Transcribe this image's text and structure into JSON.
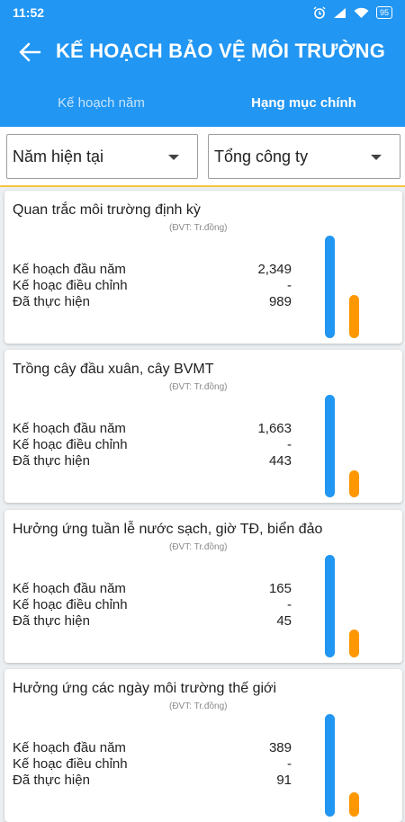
{
  "status_bar": {
    "time": "11:52",
    "battery": "95"
  },
  "app_bar": {
    "title": "KẾ HOẠCH BẢO VỆ MÔI TRƯỜNG"
  },
  "tabs": [
    {
      "label": "Kế hoạch năm",
      "active": false
    },
    {
      "label": "Hạng mục chính",
      "active": true
    }
  ],
  "filters": {
    "period": "Năm hiện tại",
    "unit": "Tổng công ty"
  },
  "labels": {
    "plan": "Kế hoạch đầu năm",
    "adjusted": "Kế hoạc điều chỉnh",
    "done": "Đã thực hiện",
    "unit": "(ĐVT: Tr.đồng)"
  },
  "colors": {
    "primary": "#2196f3",
    "plan_bar": "#2196f3",
    "done_bar": "#ff9800",
    "divider": "#f5c542"
  },
  "items": [
    {
      "title": "Quan trắc môi trường định kỳ",
      "plan": "2,349",
      "adjusted": "-",
      "done": "989",
      "plan_value": 2349,
      "done_value": 989
    },
    {
      "title": "Trồng cây đầu xuân, cây BVMT",
      "plan": "1,663",
      "adjusted": "-",
      "done": "443",
      "plan_value": 1663,
      "done_value": 443
    },
    {
      "title": "Hưởng ứng tuần lễ nước sạch, giờ TĐ, biển đảo",
      "plan": "165",
      "adjusted": "-",
      "done": "45",
      "plan_value": 165,
      "done_value": 45
    },
    {
      "title": "Hưởng ứng các ngày môi trường thế giới",
      "plan": "389",
      "adjusted": "-",
      "done": "91",
      "plan_value": 389,
      "done_value": 91
    }
  ]
}
